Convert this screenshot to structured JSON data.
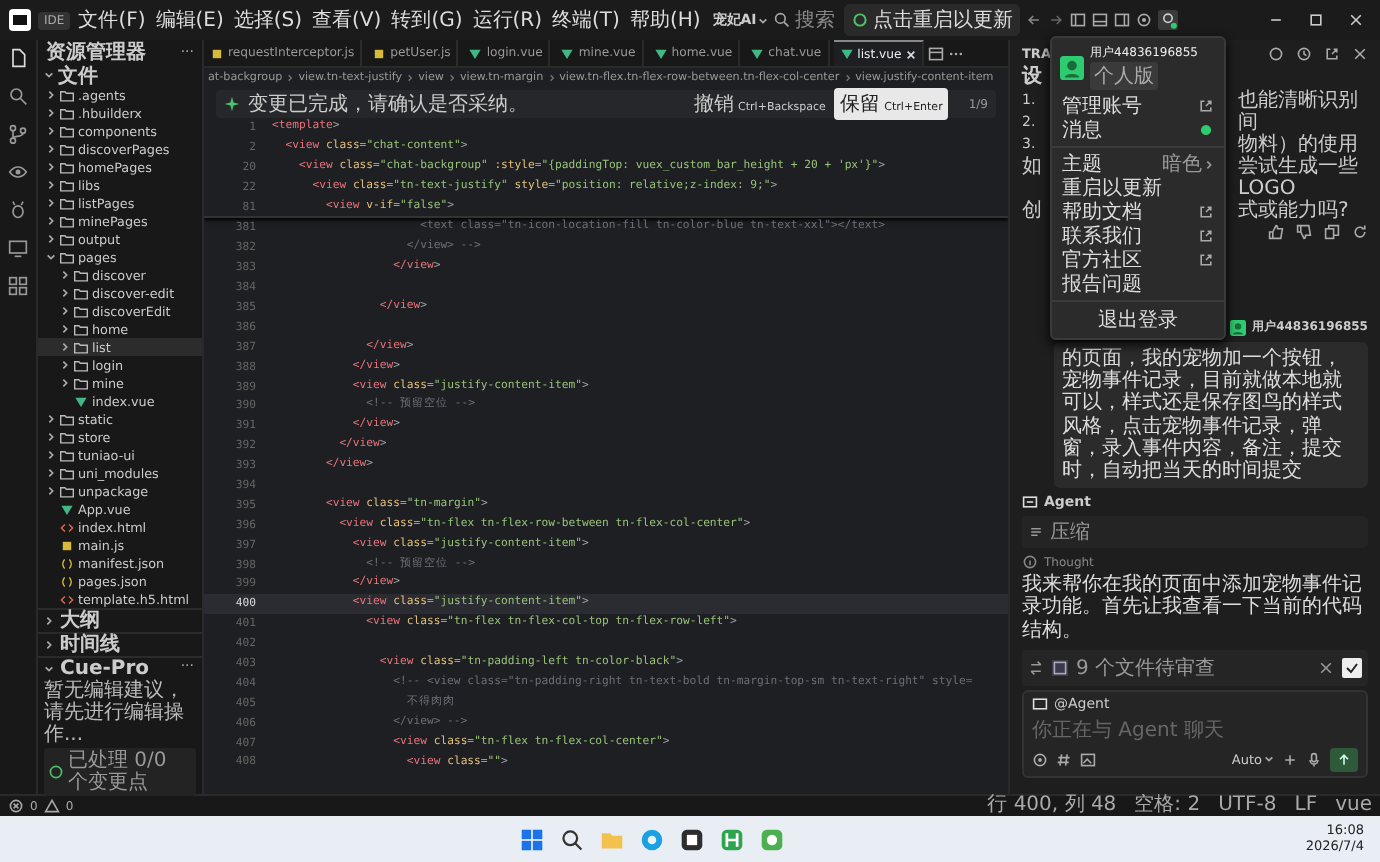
{
  "title_bar": {
    "badge": "IDE",
    "menus": [
      "文件(F)",
      "编辑(E)",
      "选择(S)",
      "查看(V)",
      "转到(G)",
      "运行(R)",
      "终端(T)",
      "帮助(H)"
    ],
    "brand": "宠妃AI",
    "search": {
      "placeholder": "搜索"
    },
    "update_button": "点击重启以更新"
  },
  "sidebar": {
    "title": "资源管理器",
    "more": "···",
    "section": "文件",
    "tree": [
      {
        "name": ".agents",
        "kind": "folder",
        "expanded": false,
        "selected": false
      },
      {
        "name": ".hbuilderx",
        "kind": "folder",
        "expanded": false,
        "selected": false
      },
      {
        "name": "components",
        "kind": "folder",
        "expanded": false,
        "selected": false
      },
      {
        "name": "discoverPages",
        "kind": "folder",
        "expanded": false,
        "selected": false
      },
      {
        "name": "homePages",
        "kind": "folder",
        "expanded": false,
        "selected": false
      },
      {
        "name": "libs",
        "kind": "folder",
        "expanded": false,
        "selected": false
      },
      {
        "name": "listPages",
        "kind": "folder",
        "expanded": false,
        "selected": false
      },
      {
        "name": "minePages",
        "kind": "folder",
        "expanded": false,
        "selected": false
      },
      {
        "name": "output",
        "kind": "folder",
        "expanded": false,
        "selected": false
      },
      {
        "name": "pages",
        "kind": "folder",
        "expanded": true,
        "selected": false,
        "children": [
          {
            "name": "discover",
            "kind": "folder",
            "expanded": false,
            "selected": false
          },
          {
            "name": "discover-edit",
            "kind": "folder",
            "expanded": false,
            "selected": false
          },
          {
            "name": "discoverEdit",
            "kind": "folder",
            "expanded": false,
            "selected": false
          },
          {
            "name": "home",
            "kind": "folder",
            "expanded": false,
            "selected": false
          },
          {
            "name": "list",
            "kind": "folder",
            "expanded": false,
            "selected": true
          },
          {
            "name": "login",
            "kind": "folder",
            "expanded": false,
            "selected": false
          },
          {
            "name": "mine",
            "kind": "folder",
            "expanded": false,
            "selected": false
          },
          {
            "name": "index.vue",
            "kind": "vue",
            "selected": false
          }
        ]
      },
      {
        "name": "static",
        "kind": "folder",
        "expanded": false,
        "selected": false
      },
      {
        "name": "store",
        "kind": "folder",
        "expanded": false,
        "selected": false
      },
      {
        "name": "tuniao-ui",
        "kind": "folder",
        "expanded": false,
        "selected": false
      },
      {
        "name": "uni_modules",
        "kind": "folder",
        "expanded": false,
        "selected": false
      },
      {
        "name": "unpackage",
        "kind": "folder",
        "expanded": false,
        "selected": false
      },
      {
        "name": "App.vue",
        "kind": "vue",
        "selected": false
      },
      {
        "name": "index.html",
        "kind": "html",
        "selected": false
      },
      {
        "name": "main.js",
        "kind": "js",
        "selected": false
      },
      {
        "name": "manifest.json",
        "kind": "json",
        "selected": false
      },
      {
        "name": "pages.json",
        "kind": "json",
        "selected": false
      },
      {
        "name": "template.h5.html",
        "kind": "html",
        "selected": false
      }
    ],
    "panels": [
      {
        "label": "大纲",
        "expanded": false
      },
      {
        "label": "时间线",
        "expanded": false
      },
      {
        "label": "Cue-Pro",
        "expanded": true
      }
    ],
    "cue_pro": {
      "more": "···",
      "message": "暂无编辑建议，请先进行编辑操作...",
      "status": "已处理 0/0 个变更点"
    }
  },
  "editor": {
    "tabs": [
      {
        "label": "requestInterceptor.js",
        "kind": "js",
        "selected": false
      },
      {
        "label": "petUser.js",
        "kind": "js",
        "selected": false
      },
      {
        "label": "login.vue",
        "kind": "vue",
        "selected": false
      },
      {
        "label": "mine.vue",
        "kind": "vue",
        "selected": false
      },
      {
        "label": "home.vue",
        "kind": "vue",
        "selected": false
      },
      {
        "label": "chat.vue",
        "kind": "vue",
        "selected": false
      },
      {
        "label": "list.vue",
        "kind": "vue",
        "selected": true
      }
    ],
    "breadcrumb": [
      "at-backgroup",
      "view.tn-text-justify",
      "view",
      "view.tn-margin",
      "view.tn-flex.tn-flex-row-between.tn-flex-col-center",
      "view.justify-content-item"
    ],
    "diff_bar": {
      "message": "变更已完成，请确认是否采纳。",
      "undo": "撤销",
      "undo_key": "Ctrl+Backspace",
      "keep": "保留",
      "keep_key": "Ctrl+Enter",
      "counter": "1/9"
    },
    "sticky_lines": [
      {
        "num": "1",
        "kind": "markup",
        "code": "<template>"
      },
      {
        "num": "2",
        "kind": "markup",
        "code": "  <view class=\"chat-content\">"
      },
      {
        "num": "20",
        "kind": "markup",
        "code": "    <view class=\"chat-backgroup\" :style=\"{paddingTop: vuex_custom_bar_height + 20 + 'px'}\">"
      },
      {
        "num": "22",
        "kind": "markup",
        "code": "      <view class=\"tn-text-justify\" style=\"position: relative;z-index: 9;\">"
      },
      {
        "num": "81",
        "kind": "markup",
        "code": "        <view v-if=\"false\">"
      }
    ],
    "lines": [
      {
        "num": "381",
        "kind": "comment",
        "current": false,
        "code": "                      <text class=\"tn-icon-location-fill tn-color-blue tn-text-xxl\"></text>"
      },
      {
        "num": "382",
        "kind": "comment",
        "current": false,
        "code": "                    </view> -->"
      },
      {
        "num": "383",
        "kind": "markup",
        "current": false,
        "code": "                  </view>"
      },
      {
        "num": "384",
        "current": false
      },
      {
        "num": "385",
        "kind": "markup",
        "current": false,
        "code": "                </view>"
      },
      {
        "num": "386",
        "current": false
      },
      {
        "num": "387",
        "kind": "markup",
        "current": false,
        "code": "              </view>"
      },
      {
        "num": "388",
        "kind": "markup",
        "current": false,
        "code": "            </view>"
      },
      {
        "num": "389",
        "kind": "markup",
        "current": false,
        "code": "            <view class=\"justify-content-item\">"
      },
      {
        "num": "390",
        "kind": "comment",
        "current": false,
        "code": "              <!-- 预留空位 -->"
      },
      {
        "num": "391",
        "kind": "markup",
        "current": false,
        "code": "            </view>"
      },
      {
        "num": "392",
        "kind": "markup",
        "current": false,
        "code": "          </view>"
      },
      {
        "num": "393",
        "kind": "markup",
        "current": false,
        "code": "        </view>"
      },
      {
        "num": "394",
        "current": false
      },
      {
        "num": "395",
        "kind": "markup",
        "current": false,
        "code": "        <view class=\"tn-margin\">"
      },
      {
        "num": "396",
        "kind": "markup",
        "current": false,
        "code": "          <view class=\"tn-flex tn-flex-row-between tn-flex-col-center\">"
      },
      {
        "num": "397",
        "kind": "markup",
        "current": false,
        "code": "            <view class=\"justify-content-item\">"
      },
      {
        "num": "398",
        "kind": "comment",
        "current": false,
        "code": "              <!-- 预留空位 -->"
      },
      {
        "num": "399",
        "kind": "markup",
        "current": false,
        "code": "            </view>"
      },
      {
        "num": "400",
        "kind": "markup",
        "current": true,
        "code": "            <view class=\"justify-content-item\">"
      },
      {
        "num": "401",
        "kind": "markup",
        "current": false,
        "code": "              <view class=\"tn-flex tn-flex-col-top tn-flex-row-left\">"
      },
      {
        "num": "402",
        "current": false
      },
      {
        "num": "403",
        "kind": "markup",
        "current": false,
        "code": "                <view class=\"tn-padding-left tn-color-black\">"
      },
      {
        "num": "404",
        "kind": "comment",
        "current": false,
        "code": "                  <!-- <view class=\"tn-padding-right tn-text-bold tn-margin-top-sm tn-text-right\" style="
      },
      {
        "num": "405",
        "kind": "comment",
        "current": false,
        "code": "                    不得肉肉"
      },
      {
        "num": "406",
        "kind": "comment",
        "current": false,
        "code": "                  </view> -->"
      },
      {
        "num": "407",
        "kind": "markup",
        "current": false,
        "code": "                  <view class=\"tn-flex tn-flex-col-center\">"
      },
      {
        "num": "408",
        "kind": "markup",
        "current": false,
        "code": "                    <view class=\"\">"
      }
    ]
  },
  "assistant": {
    "title": "TRA",
    "heading": "设",
    "list": [
      {
        "num": "1.",
        "text": "也能清晰识别"
      },
      {
        "num": "2.",
        "text": "间"
      },
      {
        "num": "3.",
        "text": "物料）的使用"
      }
    ],
    "paragraph": [
      {
        "lead": "如",
        "text": "尝试生成一些LOGO"
      },
      {
        "lead": "创",
        "text": "式或能力吗?"
      }
    ],
    "user_name": "用户44836196855",
    "user_message": "的页面，我的宠物加一个按钮，宠物事件记录，目前就做本地就可以，样式还是保存图鸟的样式风格，点击宠物事件记录，弹窗，录入事件内容，备注，提交时，自动把当天的时间提交",
    "agent_label": "Agent",
    "compress": "压缩",
    "thought": "Thought",
    "reply": "我来帮你在我的页面中添加宠物事件记录功能。首先让我查看一下当前的代码结构。",
    "review": "9 个文件待审查",
    "input": {
      "mention": "@Agent",
      "placeholder": "你正在与 Agent 聊天",
      "mode": "Auto"
    }
  },
  "account_menu": {
    "user": "用户44836196855",
    "plan": "个人版",
    "items": [
      {
        "label": "管理账号",
        "kind": "link",
        "separated": false
      },
      {
        "label": "消息",
        "kind": "dot",
        "separated": false
      },
      {
        "label": "主题",
        "kind": "submenu",
        "value": "暗色",
        "separated": true
      },
      {
        "label": "重启以更新",
        "kind": "plain",
        "separated": false
      },
      {
        "label": "帮助文档",
        "kind": "link",
        "separated": false
      },
      {
        "label": "联系我们",
        "kind": "link",
        "separated": false
      },
      {
        "label": "官方社区",
        "kind": "link",
        "separated": false
      },
      {
        "label": "报告问题",
        "kind": "plain",
        "separated": false
      }
    ],
    "logout": "退出登录"
  },
  "status_bar": {
    "errors": "0",
    "warnings": "0",
    "items": [
      "行 400, 列 48",
      "空格: 2",
      "UTF-8",
      "LF",
      "vue"
    ]
  },
  "taskbar": {
    "time": "16:08",
    "date": "2026/7/4"
  }
}
